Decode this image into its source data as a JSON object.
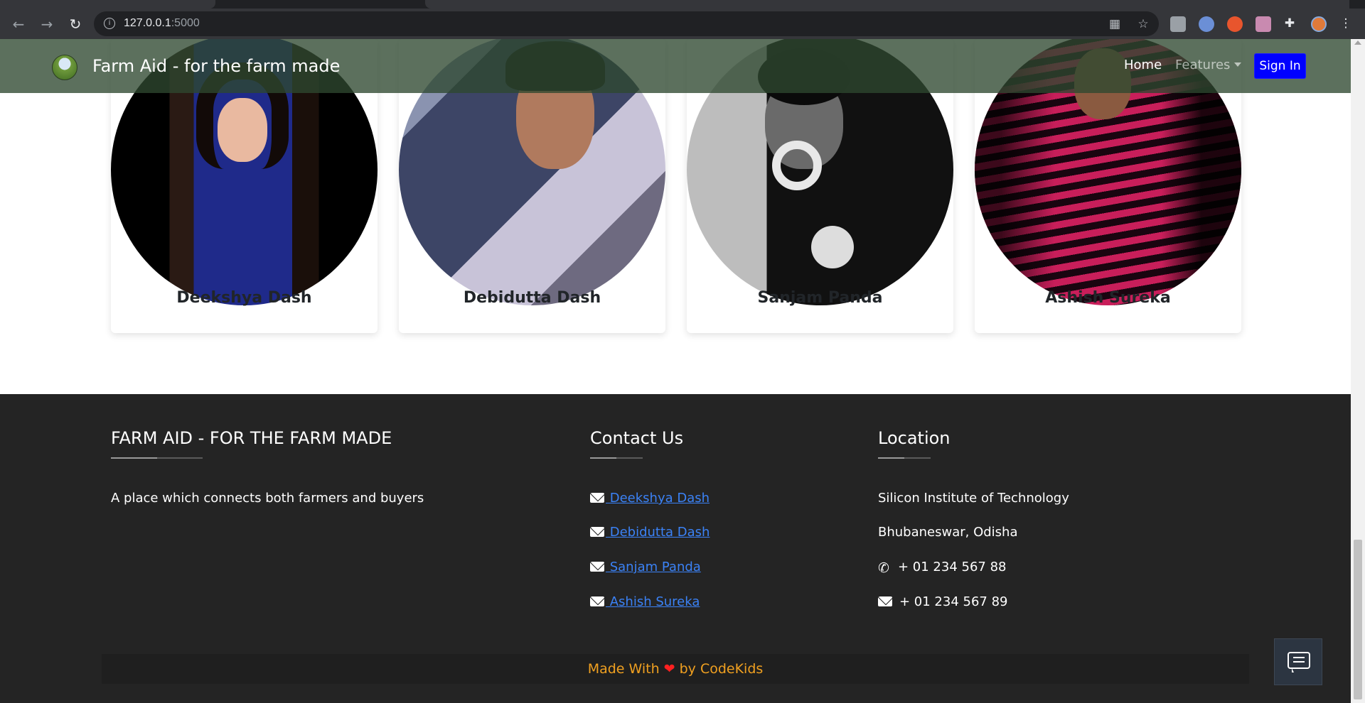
{
  "browser": {
    "url_host": "127.0.0.1",
    "url_port": ":5000",
    "back_icon": "arrow-left-icon",
    "forward_icon": "arrow-right-icon",
    "reload_icon": "reload-icon"
  },
  "navbar": {
    "brand": "Farm Aid - for the farm made",
    "links": [
      {
        "label": "Home"
      },
      {
        "label": "Features"
      }
    ],
    "signin_label": "Sign In"
  },
  "team": [
    {
      "name": "Deekshya Dash"
    },
    {
      "name": "Debidutta Dash"
    },
    {
      "name": "Sanjam Panda"
    },
    {
      "name": "Ashish Sureka"
    }
  ],
  "footer": {
    "about": {
      "heading": "FARM AID - FOR THE FARM MADE",
      "text": "A place which connects both farmers and buyers"
    },
    "contact": {
      "heading": "Contact Us",
      "links": [
        {
          "label": " Deekshya Dash"
        },
        {
          "label": " Debidutta Dash"
        },
        {
          "label": " Sanjam Panda"
        },
        {
          "label": " Ashish Sureka"
        }
      ]
    },
    "location": {
      "heading": "Location",
      "line1": "Silicon Institute of Technology",
      "line2": "Bhubaneswar, Odisha",
      "phone": "+ 01 234 567 88",
      "fax": "+ 01 234 567 89"
    },
    "made_with": {
      "prefix": "Made With",
      "suffix": "by CodeKids"
    }
  },
  "colors": {
    "navbar_bg": "#2e4830",
    "signin_bg": "#0000ff",
    "footer_bg": "#242424",
    "link": "#3b82f6",
    "made_with_text": "#f0a020",
    "heart": "#ff2020"
  }
}
